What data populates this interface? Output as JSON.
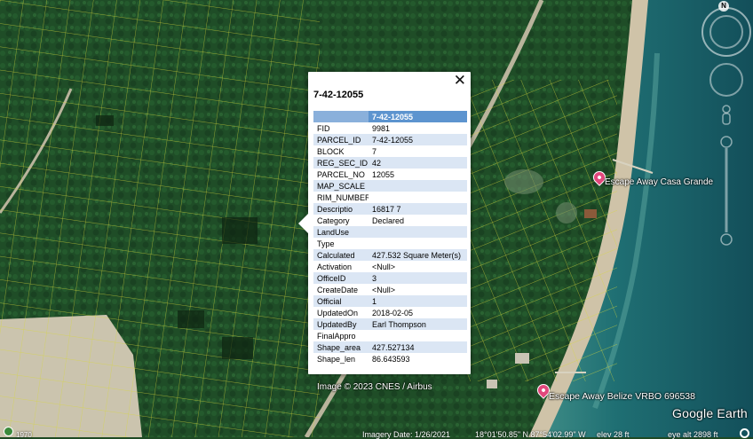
{
  "popup": {
    "title": "7-42-12055",
    "close_label": "✕",
    "header_value": "7-42-12055",
    "rows": [
      {
        "key": "FID",
        "value": "9981"
      },
      {
        "key": "PARCEL_ID",
        "value": "7-42-12055"
      },
      {
        "key": "BLOCK",
        "value": "7"
      },
      {
        "key": "REG_SEC_ID",
        "value": "42"
      },
      {
        "key": "PARCEL_NO",
        "value": "12055"
      },
      {
        "key": "MAP_SCALE",
        "value": ""
      },
      {
        "key": "RIM_NUMBER",
        "value": ""
      },
      {
        "key": "Descriptio",
        "value": "16817 7"
      },
      {
        "key": "Category",
        "value": "Declared"
      },
      {
        "key": "LandUse",
        "value": ""
      },
      {
        "key": "Type",
        "value": ""
      },
      {
        "key": "Calculated",
        "value": "427.532 Square Meter(s)"
      },
      {
        "key": "Activation",
        "value": "<Null>"
      },
      {
        "key": "OfficeID",
        "value": "3"
      },
      {
        "key": "CreateDate",
        "value": "<Null>"
      },
      {
        "key": "Official",
        "value": "1"
      },
      {
        "key": "UpdatedOn",
        "value": "2018-02-05"
      },
      {
        "key": "UpdatedBy",
        "value": "Earl Thompson"
      },
      {
        "key": "FinalAppro",
        "value": ""
      },
      {
        "key": "Shape_area",
        "value": "427.527134"
      },
      {
        "key": "Shape_len",
        "value": "86.643593"
      }
    ]
  },
  "places": [
    {
      "label": "Escape Away Casa Grande"
    },
    {
      "label": "Escape Away Belize VRBO 696538"
    }
  ],
  "attribution": "Image © 2023 CNES / Airbus",
  "logo": "Google Earth",
  "compass_letter": "N",
  "status": {
    "year": "1970",
    "imagery_date": "Imagery Date: 1/26/2021",
    "coords": "18°01'50.85\" N  87°54'02.99\" W",
    "elev": "elev   28 ft",
    "eye_alt": "eye alt  2898 ft"
  },
  "colors": {
    "parcel_lines": "#e6e640",
    "popup_header": "#5d94cf",
    "popup_alt_row": "#dbe6f4",
    "pin": "#e2487c"
  }
}
